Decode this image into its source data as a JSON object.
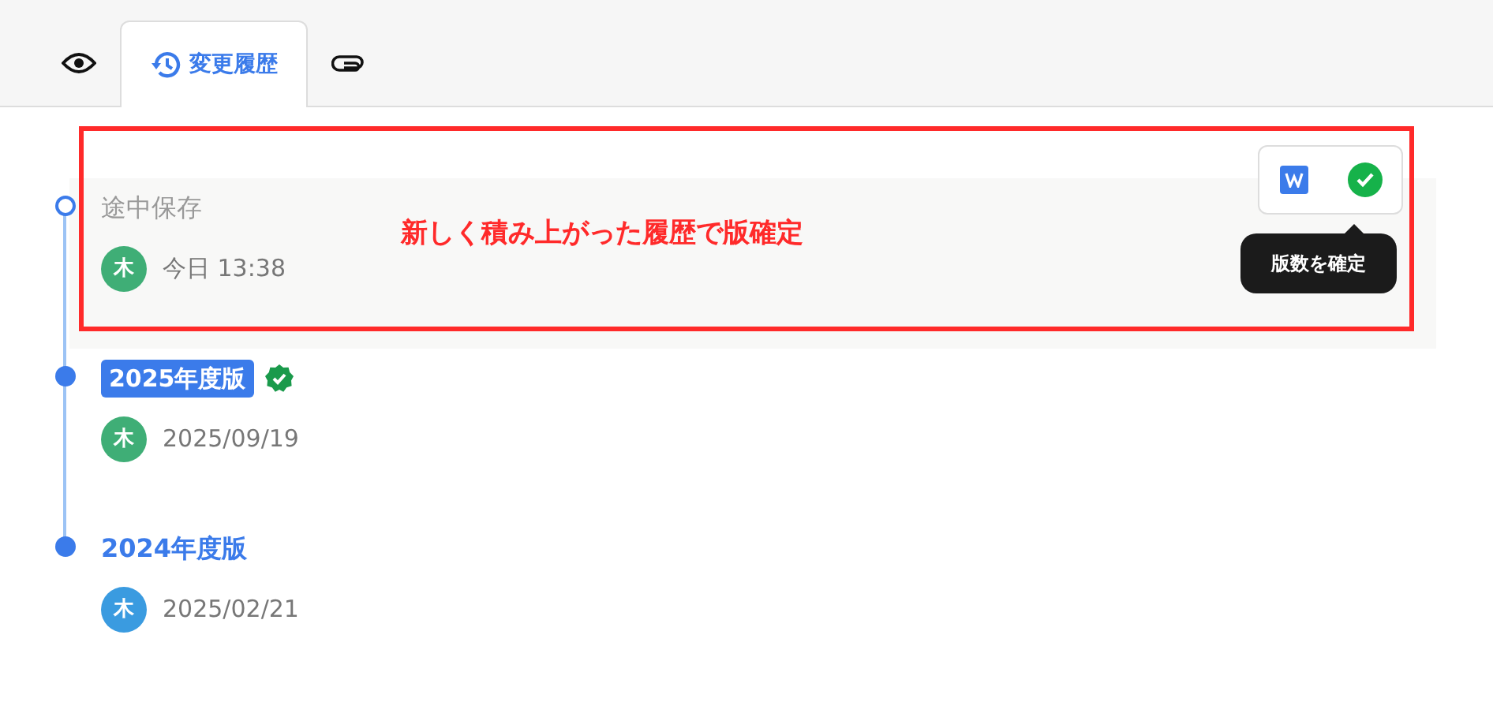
{
  "tabs": [
    {
      "kind": "preview",
      "selected": false
    },
    {
      "kind": "history",
      "label": "変更履歴",
      "selected": true
    },
    {
      "kind": "attachments",
      "selected": false
    }
  ],
  "history": [
    {
      "kind": "draft",
      "title": "途中保存",
      "avatar": "木",
      "color": "#3fae76",
      "date": "今日 13:38"
    },
    {
      "kind": "badge",
      "title": "2025年度版",
      "avatar": "木",
      "color": "#3fae76",
      "date": "2025/09/19",
      "verified": true
    },
    {
      "kind": "plain",
      "title": "2024年度版",
      "avatar": "木",
      "color": "#3a9be0",
      "date": "2025/02/21"
    }
  ],
  "annotation": {
    "text": "新しく積み上がった履歴で版確定"
  },
  "toolbar": {
    "tooltip": "版数を確定"
  }
}
